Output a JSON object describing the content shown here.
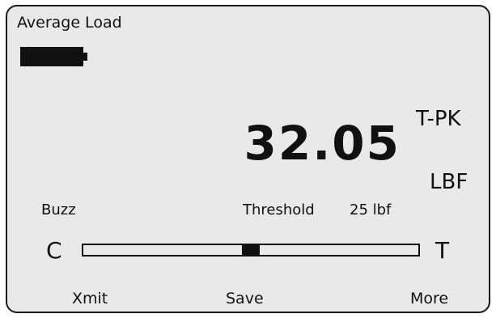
{
  "screen": {
    "title": "Average Load",
    "battery": "battery-icon"
  },
  "reading": {
    "value": "32.05",
    "mode": "T-PK",
    "unit": "LBF"
  },
  "status": {
    "buzz_label": "Buzz",
    "threshold_label": "Threshold",
    "threshold_value": "25 lbf"
  },
  "load_bar": {
    "left_label": "C",
    "right_label": "T",
    "position": 0.5
  },
  "softkeys": [
    {
      "label": "Xmit"
    },
    {
      "label": "Save"
    },
    {
      "label": "More"
    }
  ],
  "colors": {
    "background": "#e9e9e9",
    "foreground": "#111111"
  }
}
